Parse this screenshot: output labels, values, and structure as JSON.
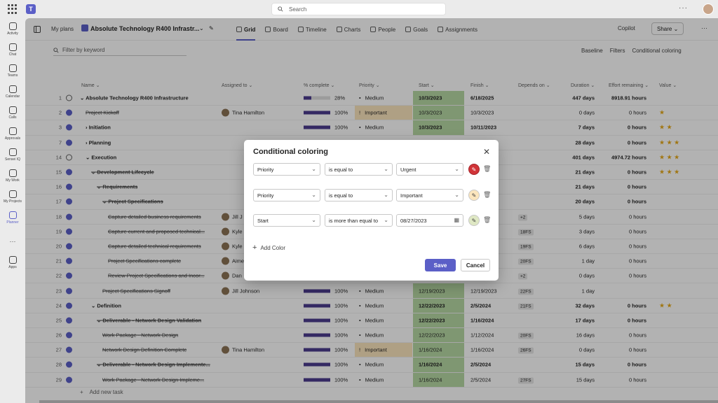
{
  "topbar": {
    "search_placeholder": "Search",
    "more": "···"
  },
  "rail": [
    {
      "label": "Activity",
      "icon": "bell-icon"
    },
    {
      "label": "Chat",
      "icon": "chat-icon"
    },
    {
      "label": "Teams",
      "icon": "teams-icon"
    },
    {
      "label": "Calendar",
      "icon": "calendar-icon"
    },
    {
      "label": "Calls",
      "icon": "phone-icon"
    },
    {
      "label": "Approvals",
      "icon": "approvals-icon"
    },
    {
      "label": "Sensei IQ",
      "icon": "sensei-icon"
    },
    {
      "label": "My Work",
      "icon": "mywork-icon"
    },
    {
      "label": "My Projects",
      "icon": "myprojects-icon"
    },
    {
      "label": "Planner",
      "icon": "planner-icon"
    },
    {
      "label": "···",
      "icon": "more-icon"
    },
    {
      "label": "Apps",
      "icon": "apps-icon"
    }
  ],
  "header": {
    "breadcrumb": "My plans",
    "plan_title": "Absolute Technology R400 Infrastr...",
    "tabs": [
      "Grid",
      "Board",
      "Timeline",
      "Charts",
      "People",
      "Goals",
      "Assignments"
    ],
    "copilot": "Copilot",
    "share": "Share"
  },
  "toolbar": {
    "filter_placeholder": "Filter by keyword",
    "baseline": "Baseline",
    "filters": "Filters",
    "conditional": "Conditional coloring"
  },
  "columns": {
    "name": "Name",
    "assigned": "Assigned to",
    "pct": "% complete",
    "priority": "Priority",
    "start": "Start",
    "finish": "Finish",
    "depends": "Depends on",
    "duration": "Duration",
    "effort": "Effort remaining",
    "value": "Value"
  },
  "rows": [
    {
      "num": "1",
      "done": false,
      "name": "Absolute Technology R400 Infrastructure",
      "indent": 0,
      "bold": true,
      "strike": false,
      "assigned": "",
      "pct": 28,
      "pct_label": "28%",
      "priority": "Medium",
      "pri_icon": "•",
      "pri_hl": false,
      "start": "10/3/2023",
      "finish": "6/18/2025",
      "dep": "",
      "dur": "447 days",
      "effort": "8918.91 hours",
      "stars": "",
      "caret": "⌄"
    },
    {
      "num": "2",
      "done": true,
      "name": "Project Kickoff",
      "indent": 1,
      "bold": false,
      "strike": true,
      "assigned": "Tina Hamilton",
      "pct": 100,
      "pct_label": "100%",
      "priority": "Important",
      "pri_icon": "!",
      "pri_hl": true,
      "start": "10/3/2023",
      "finish": "10/3/2023",
      "dep": "",
      "dur": "0 days",
      "effort": "0 hours",
      "stars": "★",
      "caret": ""
    },
    {
      "num": "3",
      "done": true,
      "name": "Initiation",
      "indent": 1,
      "bold": true,
      "strike": false,
      "assigned": "",
      "pct": 100,
      "pct_label": "100%",
      "priority": "Medium",
      "pri_icon": "•",
      "pri_hl": false,
      "start": "10/3/2023",
      "finish": "10/11/2023",
      "dep": "",
      "dur": "7 days",
      "effort": "0 hours",
      "stars": "★ ★",
      "caret": "›"
    },
    {
      "num": "7",
      "done": true,
      "name": "Planning",
      "indent": 1,
      "bold": true,
      "strike": false,
      "assigned": "",
      "pct": 100,
      "pct_label": "",
      "priority": "",
      "pri_icon": "",
      "pri_hl": false,
      "start": "",
      "finish": "",
      "dep": "",
      "dur": "28 days",
      "effort": "0 hours",
      "stars": "★ ★ ★",
      "caret": "›"
    },
    {
      "num": "14",
      "done": false,
      "name": "Execution",
      "indent": 1,
      "bold": true,
      "strike": false,
      "assigned": "",
      "pct": 0,
      "pct_label": "",
      "priority": "",
      "pri_icon": "",
      "pri_hl": false,
      "start": "",
      "finish": "",
      "dep": "",
      "dur": "401 days",
      "effort": "4974.72 hours",
      "stars": "★ ★ ★",
      "caret": "⌄"
    },
    {
      "num": "15",
      "done": true,
      "name": "Development Lifecycle",
      "indent": 2,
      "bold": true,
      "strike": true,
      "assigned": "",
      "pct": 0,
      "pct_label": "",
      "priority": "",
      "pri_icon": "",
      "pri_hl": false,
      "start": "",
      "finish": "",
      "dep": "",
      "dur": "21 days",
      "effort": "0 hours",
      "stars": "★ ★ ★",
      "caret": "⌄"
    },
    {
      "num": "16",
      "done": true,
      "name": "Requirements",
      "indent": 3,
      "bold": true,
      "strike": true,
      "assigned": "",
      "pct": 0,
      "pct_label": "",
      "priority": "",
      "pri_icon": "",
      "pri_hl": false,
      "start": "",
      "finish": "",
      "dep": "",
      "dur": "21 days",
      "effort": "0 hours",
      "stars": "",
      "caret": "⌄"
    },
    {
      "num": "17",
      "done": true,
      "name": "Project Specifications",
      "indent": 4,
      "bold": true,
      "strike": true,
      "assigned": "",
      "pct": 0,
      "pct_label": "",
      "priority": "",
      "pri_icon": "",
      "pri_hl": false,
      "start": "",
      "finish": "",
      "dep": "",
      "dur": "20 days",
      "effort": "0 hours",
      "stars": "",
      "caret": "⌄"
    },
    {
      "num": "18",
      "done": true,
      "name": "Capture detailed business requirements",
      "indent": 5,
      "bold": false,
      "strike": true,
      "assigned": "Jill J",
      "pct": 0,
      "pct_label": "",
      "priority": "",
      "pri_icon": "",
      "pri_hl": false,
      "start": "",
      "finish": "",
      "dep": "+2",
      "dur": "5 days",
      "effort": "0 hours",
      "stars": "",
      "caret": ""
    },
    {
      "num": "19",
      "done": true,
      "name": "Capture current and proposed technical...",
      "indent": 5,
      "bold": false,
      "strike": true,
      "assigned": "Kyle",
      "pct": 0,
      "pct_label": "",
      "priority": "",
      "pri_icon": "",
      "pri_hl": false,
      "start": "",
      "finish": "",
      "dep": "18FS",
      "dur": "3 days",
      "effort": "0 hours",
      "stars": "",
      "caret": ""
    },
    {
      "num": "20",
      "done": true,
      "name": "Capture detailed technical requirements",
      "indent": 5,
      "bold": false,
      "strike": true,
      "assigned": "Kyle",
      "pct": 0,
      "pct_label": "",
      "priority": "",
      "pri_icon": "",
      "pri_hl": false,
      "start": "",
      "finish": "",
      "dep": "19FS",
      "dur": "6 days",
      "effort": "0 hours",
      "stars": "",
      "caret": ""
    },
    {
      "num": "21",
      "done": true,
      "name": "Project Specifications complete",
      "indent": 5,
      "bold": false,
      "strike": true,
      "assigned": "Aimee",
      "pct": 0,
      "pct_label": "",
      "priority": "",
      "pri_icon": "",
      "pri_hl": false,
      "start": "",
      "finish": "",
      "dep": "20FS",
      "dur": "1 day",
      "effort": "0 hours",
      "stars": "",
      "caret": ""
    },
    {
      "num": "22",
      "done": true,
      "name": "Review Project Specifications and Incor...",
      "indent": 5,
      "bold": false,
      "strike": true,
      "assigned": "Dan",
      "pct": 0,
      "pct_label": "",
      "priority": "",
      "pri_icon": "",
      "pri_hl": false,
      "start": "",
      "finish": "",
      "dep": "+2",
      "dur": "0 days",
      "effort": "0 hours",
      "stars": "",
      "caret": ""
    },
    {
      "num": "23",
      "done": true,
      "name": "Project Specifications Signoff",
      "indent": 4,
      "bold": false,
      "strike": true,
      "assigned": "Jill Johnson",
      "pct": 100,
      "pct_label": "100%",
      "priority": "Medium",
      "pri_icon": "•",
      "pri_hl": false,
      "start": "12/19/2023",
      "finish": "12/19/2023",
      "dep": "22FS",
      "dur": "1 day",
      "effort": "",
      "stars": "",
      "caret": ""
    },
    {
      "num": "24",
      "done": true,
      "name": "Definition",
      "indent": 2,
      "bold": true,
      "strike": false,
      "assigned": "",
      "pct": 100,
      "pct_label": "100%",
      "priority": "Medium",
      "pri_icon": "•",
      "pri_hl": false,
      "start": "12/22/2023",
      "finish": "2/5/2024",
      "dep": "21FS",
      "dur": "32 days",
      "effort": "0 hours",
      "stars": "★ ★",
      "caret": "⌄"
    },
    {
      "num": "25",
      "done": true,
      "name": "Deliverable - Network Design Validation",
      "indent": 3,
      "bold": true,
      "strike": true,
      "assigned": "",
      "pct": 100,
      "pct_label": "100%",
      "priority": "Medium",
      "pri_icon": "•",
      "pri_hl": false,
      "start": "12/22/2023",
      "finish": "1/16/2024",
      "dep": "",
      "dur": "17 days",
      "effort": "0 hours",
      "stars": "",
      "caret": "⌄"
    },
    {
      "num": "26",
      "done": true,
      "name": "Work Package - Network Design",
      "indent": 4,
      "bold": false,
      "strike": true,
      "assigned": "",
      "pct": 100,
      "pct_label": "100%",
      "priority": "Medium",
      "pri_icon": "•",
      "pri_hl": false,
      "start": "12/22/2023",
      "finish": "1/12/2024",
      "dep": "20FS",
      "dur": "16 days",
      "effort": "0 hours",
      "stars": "",
      "caret": ""
    },
    {
      "num": "27",
      "done": true,
      "name": "Network Design Definition Complete",
      "indent": 4,
      "bold": false,
      "strike": true,
      "assigned": "Tina Hamilton",
      "pct": 100,
      "pct_label": "100%",
      "priority": "Important",
      "pri_icon": "!",
      "pri_hl": true,
      "start": "1/16/2024",
      "finish": "1/16/2024",
      "dep": "26FS",
      "dur": "0 days",
      "effort": "0 hours",
      "stars": "",
      "caret": ""
    },
    {
      "num": "28",
      "done": true,
      "name": "Deliverable - Network Design Implemente...",
      "indent": 3,
      "bold": true,
      "strike": true,
      "assigned": "",
      "pct": 100,
      "pct_label": "100%",
      "priority": "Medium",
      "pri_icon": "•",
      "pri_hl": false,
      "start": "1/16/2024",
      "finish": "2/5/2024",
      "dep": "",
      "dur": "15 days",
      "effort": "0 hours",
      "stars": "",
      "caret": "⌄"
    },
    {
      "num": "29",
      "done": true,
      "name": "Work Package - Network Design Impleme...",
      "indent": 4,
      "bold": false,
      "strike": true,
      "assigned": "",
      "pct": 100,
      "pct_label": "100%",
      "priority": "Medium",
      "pri_icon": "•",
      "pri_hl": false,
      "start": "1/16/2024",
      "finish": "2/5/2024",
      "dep": "27FS",
      "dur": "15 days",
      "effort": "0 hours",
      "stars": "",
      "caret": ""
    }
  ],
  "add_task": "Add new task",
  "dialog": {
    "title": "Conditional coloring",
    "rules": [
      {
        "field": "Priority",
        "op": "is equal to",
        "value": "Urgent",
        "color": "#d13438"
      },
      {
        "field": "Priority",
        "op": "is equal to",
        "value": "Important",
        "color": "#fbe5bd"
      },
      {
        "field": "Start",
        "op": "is more than equal to",
        "value": "08/27/2023",
        "color": "#dfe8c4"
      }
    ],
    "add_color": "Add Color",
    "save": "Save",
    "cancel": "Cancel"
  }
}
